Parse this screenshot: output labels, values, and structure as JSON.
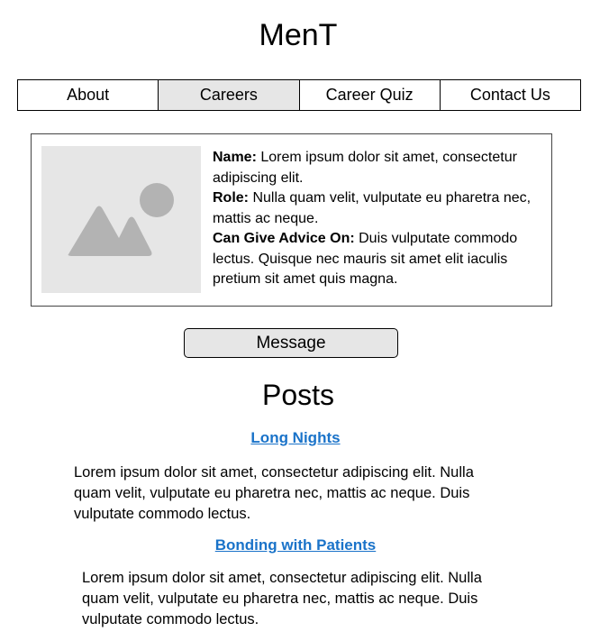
{
  "site": {
    "title": "MenT"
  },
  "nav": {
    "items": [
      {
        "label": "About",
        "active": false
      },
      {
        "label": "Careers",
        "active": true
      },
      {
        "label": "Career Quiz",
        "active": false
      },
      {
        "label": "Contact Us",
        "active": false
      }
    ]
  },
  "profile": {
    "image_icon": "image-placeholder-icon",
    "name_label": "Name:",
    "name_value": " Lorem ipsum dolor sit amet, consectetur adipiscing elit.",
    "role_label": "Role:",
    "role_value": " Nulla quam velit, vulputate eu pharetra nec, mattis ac neque.",
    "advice_label": "Can Give Advice On:",
    "advice_value": " Duis vulputate commodo lectus. Quisque nec mauris sit amet elit iaculis pretium sit amet quis magna."
  },
  "message_button": {
    "label": "Message"
  },
  "posts": {
    "heading": "Posts",
    "items": [
      {
        "title": "Long Nights",
        "body": "Lorem ipsum dolor sit amet, consectetur adipiscing elit. Nulla quam velit, vulputate eu pharetra nec, mattis ac neque. Duis vulputate commodo lectus."
      },
      {
        "title": "Bonding with Patients",
        "body": "Lorem ipsum dolor sit amet, consectetur adipiscing elit. Nulla quam velit, vulputate eu pharetra nec, mattis ac neque. Duis vulputate commodo lectus."
      }
    ]
  },
  "colors": {
    "link": "#1a73c9",
    "active_tab": "#e6e6e6",
    "placeholder_bg": "#e6e6e6",
    "placeholder_fg": "#b3b3b3"
  }
}
